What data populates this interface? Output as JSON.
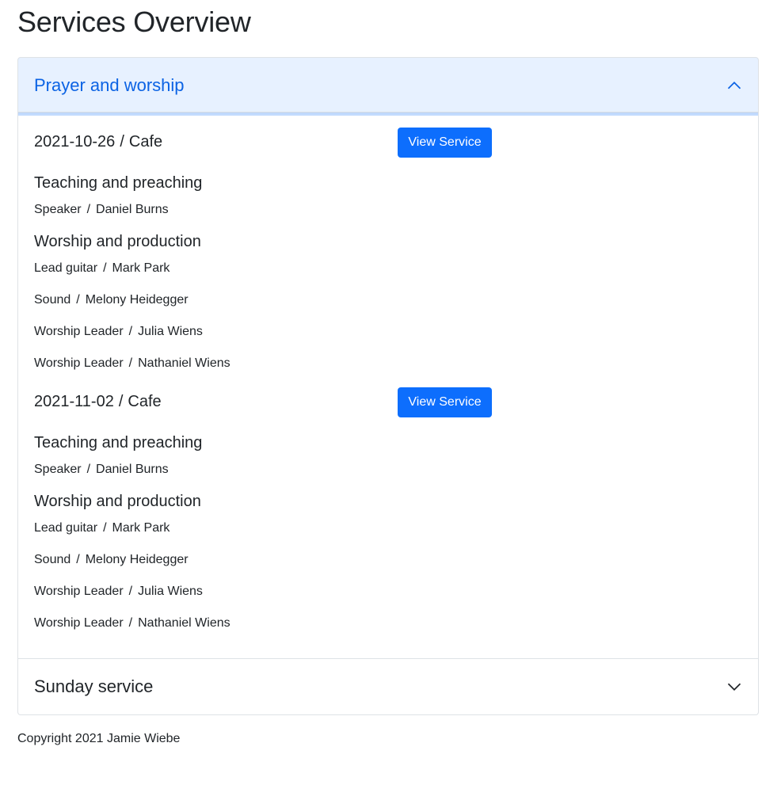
{
  "page": {
    "title": "Services Overview"
  },
  "accordion": {
    "items": [
      {
        "title": "Prayer and worship",
        "expanded": true,
        "services": [
          {
            "date": "2021-10-26",
            "location": "Cafe",
            "view_label": "View Service",
            "groups": [
              {
                "title": "Teaching and preaching",
                "roles": [
                  {
                    "role": "Speaker",
                    "person": "Daniel Burns"
                  }
                ]
              },
              {
                "title": "Worship and production",
                "roles": [
                  {
                    "role": "Lead guitar",
                    "person": "Mark Park"
                  },
                  {
                    "role": "Sound",
                    "person": "Melony Heidegger"
                  },
                  {
                    "role": "Worship Leader",
                    "person": "Julia Wiens"
                  },
                  {
                    "role": "Worship Leader",
                    "person": "Nathaniel Wiens"
                  }
                ]
              }
            ]
          },
          {
            "date": "2021-11-02",
            "location": "Cafe",
            "view_label": "View Service",
            "groups": [
              {
                "title": "Teaching and preaching",
                "roles": [
                  {
                    "role": "Speaker",
                    "person": "Daniel Burns"
                  }
                ]
              },
              {
                "title": "Worship and production",
                "roles": [
                  {
                    "role": "Lead guitar",
                    "person": "Mark Park"
                  },
                  {
                    "role": "Sound",
                    "person": "Melony Heidegger"
                  },
                  {
                    "role": "Worship Leader",
                    "person": "Julia Wiens"
                  },
                  {
                    "role": "Worship Leader",
                    "person": "Nathaniel Wiens"
                  }
                ]
              }
            ]
          }
        ]
      },
      {
        "title": "Sunday service",
        "expanded": false
      }
    ]
  },
  "separator": "/",
  "icons": {
    "expanded": "chevron-up-icon",
    "collapsed": "chevron-down-icon"
  },
  "colors": {
    "accent": "#0d6efd",
    "header_active_bg": "#e7f1ff",
    "header_active_text": "#0c63e4"
  },
  "footer": {
    "text": "Copyright 2021 Jamie Wiebe"
  }
}
